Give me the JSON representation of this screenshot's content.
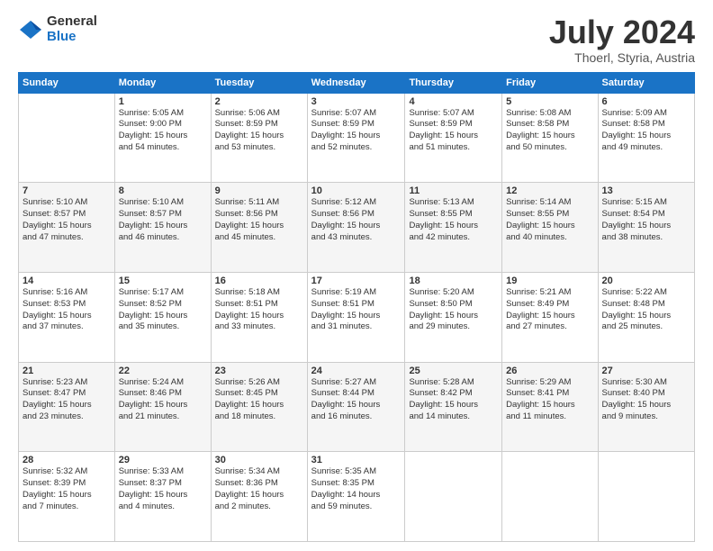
{
  "logo": {
    "general": "General",
    "blue": "Blue"
  },
  "title": {
    "month_year": "July 2024",
    "location": "Thoerl, Styria, Austria"
  },
  "weekdays": [
    "Sunday",
    "Monday",
    "Tuesday",
    "Wednesday",
    "Thursday",
    "Friday",
    "Saturday"
  ],
  "weeks": [
    [
      {
        "day": "",
        "info": ""
      },
      {
        "day": "1",
        "info": "Sunrise: 5:05 AM\nSunset: 9:00 PM\nDaylight: 15 hours\nand 54 minutes."
      },
      {
        "day": "2",
        "info": "Sunrise: 5:06 AM\nSunset: 8:59 PM\nDaylight: 15 hours\nand 53 minutes."
      },
      {
        "day": "3",
        "info": "Sunrise: 5:07 AM\nSunset: 8:59 PM\nDaylight: 15 hours\nand 52 minutes."
      },
      {
        "day": "4",
        "info": "Sunrise: 5:07 AM\nSunset: 8:59 PM\nDaylight: 15 hours\nand 51 minutes."
      },
      {
        "day": "5",
        "info": "Sunrise: 5:08 AM\nSunset: 8:58 PM\nDaylight: 15 hours\nand 50 minutes."
      },
      {
        "day": "6",
        "info": "Sunrise: 5:09 AM\nSunset: 8:58 PM\nDaylight: 15 hours\nand 49 minutes."
      }
    ],
    [
      {
        "day": "7",
        "info": "Sunrise: 5:10 AM\nSunset: 8:57 PM\nDaylight: 15 hours\nand 47 minutes."
      },
      {
        "day": "8",
        "info": "Sunrise: 5:10 AM\nSunset: 8:57 PM\nDaylight: 15 hours\nand 46 minutes."
      },
      {
        "day": "9",
        "info": "Sunrise: 5:11 AM\nSunset: 8:56 PM\nDaylight: 15 hours\nand 45 minutes."
      },
      {
        "day": "10",
        "info": "Sunrise: 5:12 AM\nSunset: 8:56 PM\nDaylight: 15 hours\nand 43 minutes."
      },
      {
        "day": "11",
        "info": "Sunrise: 5:13 AM\nSunset: 8:55 PM\nDaylight: 15 hours\nand 42 minutes."
      },
      {
        "day": "12",
        "info": "Sunrise: 5:14 AM\nSunset: 8:55 PM\nDaylight: 15 hours\nand 40 minutes."
      },
      {
        "day": "13",
        "info": "Sunrise: 5:15 AM\nSunset: 8:54 PM\nDaylight: 15 hours\nand 38 minutes."
      }
    ],
    [
      {
        "day": "14",
        "info": "Sunrise: 5:16 AM\nSunset: 8:53 PM\nDaylight: 15 hours\nand 37 minutes."
      },
      {
        "day": "15",
        "info": "Sunrise: 5:17 AM\nSunset: 8:52 PM\nDaylight: 15 hours\nand 35 minutes."
      },
      {
        "day": "16",
        "info": "Sunrise: 5:18 AM\nSunset: 8:51 PM\nDaylight: 15 hours\nand 33 minutes."
      },
      {
        "day": "17",
        "info": "Sunrise: 5:19 AM\nSunset: 8:51 PM\nDaylight: 15 hours\nand 31 minutes."
      },
      {
        "day": "18",
        "info": "Sunrise: 5:20 AM\nSunset: 8:50 PM\nDaylight: 15 hours\nand 29 minutes."
      },
      {
        "day": "19",
        "info": "Sunrise: 5:21 AM\nSunset: 8:49 PM\nDaylight: 15 hours\nand 27 minutes."
      },
      {
        "day": "20",
        "info": "Sunrise: 5:22 AM\nSunset: 8:48 PM\nDaylight: 15 hours\nand 25 minutes."
      }
    ],
    [
      {
        "day": "21",
        "info": "Sunrise: 5:23 AM\nSunset: 8:47 PM\nDaylight: 15 hours\nand 23 minutes."
      },
      {
        "day": "22",
        "info": "Sunrise: 5:24 AM\nSunset: 8:46 PM\nDaylight: 15 hours\nand 21 minutes."
      },
      {
        "day": "23",
        "info": "Sunrise: 5:26 AM\nSunset: 8:45 PM\nDaylight: 15 hours\nand 18 minutes."
      },
      {
        "day": "24",
        "info": "Sunrise: 5:27 AM\nSunset: 8:44 PM\nDaylight: 15 hours\nand 16 minutes."
      },
      {
        "day": "25",
        "info": "Sunrise: 5:28 AM\nSunset: 8:42 PM\nDaylight: 15 hours\nand 14 minutes."
      },
      {
        "day": "26",
        "info": "Sunrise: 5:29 AM\nSunset: 8:41 PM\nDaylight: 15 hours\nand 11 minutes."
      },
      {
        "day": "27",
        "info": "Sunrise: 5:30 AM\nSunset: 8:40 PM\nDaylight: 15 hours\nand 9 minutes."
      }
    ],
    [
      {
        "day": "28",
        "info": "Sunrise: 5:32 AM\nSunset: 8:39 PM\nDaylight: 15 hours\nand 7 minutes."
      },
      {
        "day": "29",
        "info": "Sunrise: 5:33 AM\nSunset: 8:37 PM\nDaylight: 15 hours\nand 4 minutes."
      },
      {
        "day": "30",
        "info": "Sunrise: 5:34 AM\nSunset: 8:36 PM\nDaylight: 15 hours\nand 2 minutes."
      },
      {
        "day": "31",
        "info": "Sunrise: 5:35 AM\nSunset: 8:35 PM\nDaylight: 14 hours\nand 59 minutes."
      },
      {
        "day": "",
        "info": ""
      },
      {
        "day": "",
        "info": ""
      },
      {
        "day": "",
        "info": ""
      }
    ]
  ]
}
